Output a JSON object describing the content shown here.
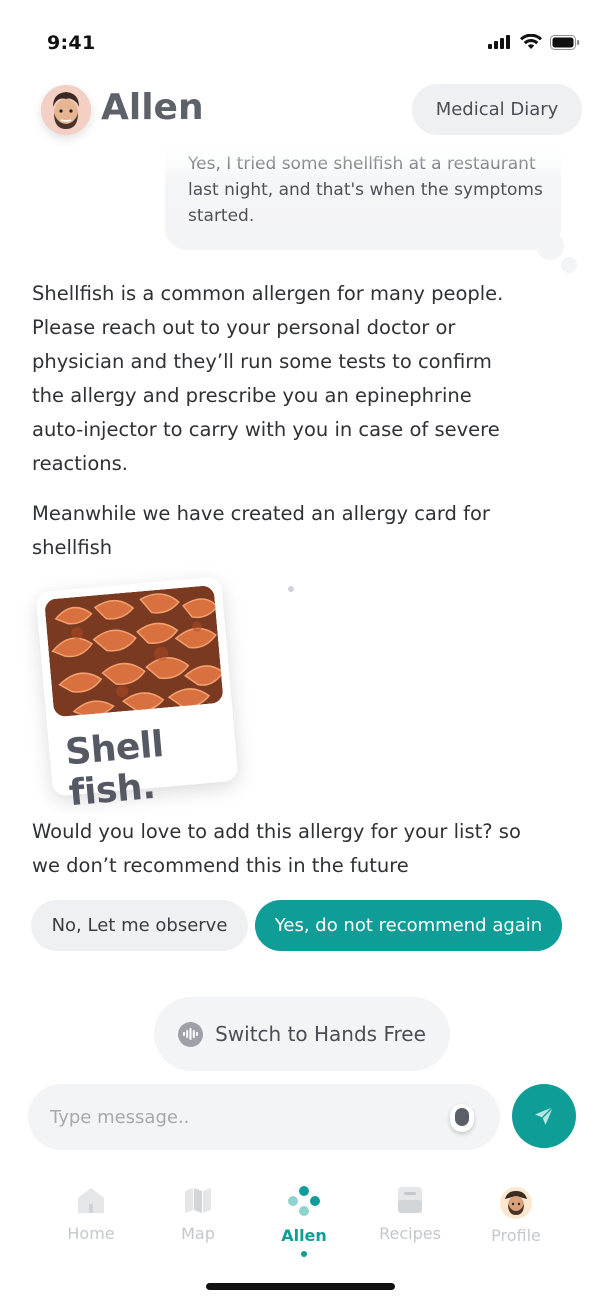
{
  "status_bar": {
    "time": "9:41"
  },
  "header": {
    "title": "Allen",
    "diary_label": "Medical Diary"
  },
  "conversation": {
    "user_message": "Yes, I tried some shellfish at a restaurant last night, and that's when the symptoms started.",
    "bot_message_1": "Shellfish is a common allergen for many people. Please reach out to your personal doctor or physician and they’ll run some tests to confirm the allergy and prescribe you an epinephrine auto-injector to carry with you in case of severe reactions.",
    "bot_message_2": "Meanwhile we have created an allergy card for shellfish",
    "allergy_card": {
      "label": "Shell fish."
    },
    "bot_message_3": "Would you love to add this allergy for your list? so we don’t recommend this in the future",
    "choices": {
      "no_label": "No, Let me observe",
      "yes_label": "Yes, do not recommend again"
    }
  },
  "hands_free": {
    "label": "Switch to Hands Free",
    "icon": "waveform-icon"
  },
  "composer": {
    "placeholder": "Type message..",
    "mic_icon": "microphone-icon",
    "send_icon": "send-icon"
  },
  "tabbar": {
    "items": [
      {
        "label": "Home",
        "icon": "home-icon"
      },
      {
        "label": "Map",
        "icon": "map-icon"
      },
      {
        "label": "Allen",
        "icon": "allen-icon",
        "active": true
      },
      {
        "label": "Recipes",
        "icon": "recipes-icon"
      },
      {
        "label": "Profile",
        "icon": "profile-avatar-icon"
      }
    ]
  },
  "colors": {
    "accent": "#0f9d97",
    "bubble": "#f3f4f5",
    "text": "#2f3134"
  }
}
